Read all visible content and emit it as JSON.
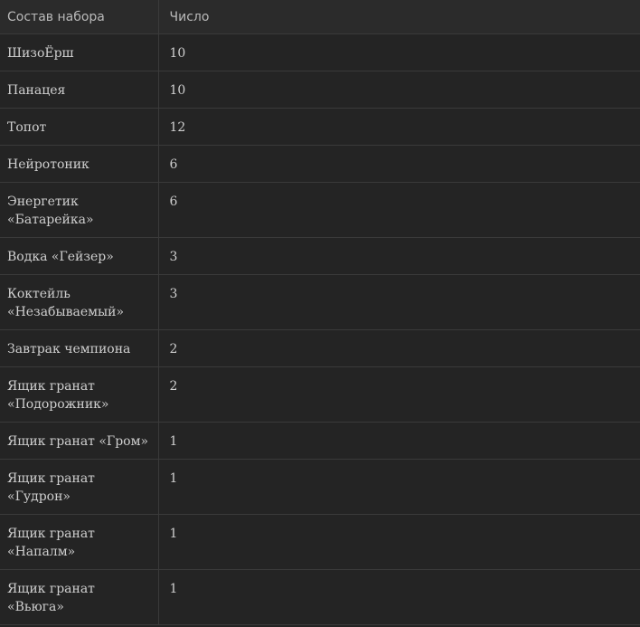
{
  "table": {
    "headers": [
      "Состав набора",
      "Число"
    ],
    "rows": [
      [
        "ШизоЁрш",
        "10"
      ],
      [
        "Панацея",
        "10"
      ],
      [
        "Топот",
        "12"
      ],
      [
        "Нейротоник",
        "6"
      ],
      [
        "Энергетик «Батарейка»",
        "6"
      ],
      [
        "Водка «Гейзер»",
        "3"
      ],
      [
        "Коктейль «Незабываемый»",
        "3"
      ],
      [
        "Завтрак чемпиона",
        "2"
      ],
      [
        "Ящик гранат «Подорожник»",
        "2"
      ],
      [
        "Ящик гранат «Гром»",
        "1"
      ],
      [
        "Ящик гранат «Гудрон»",
        "1"
      ],
      [
        "Ящик гранат «Напалм»",
        "1"
      ],
      [
        "Ящик гранат «Вьюга»",
        "1"
      ]
    ]
  }
}
